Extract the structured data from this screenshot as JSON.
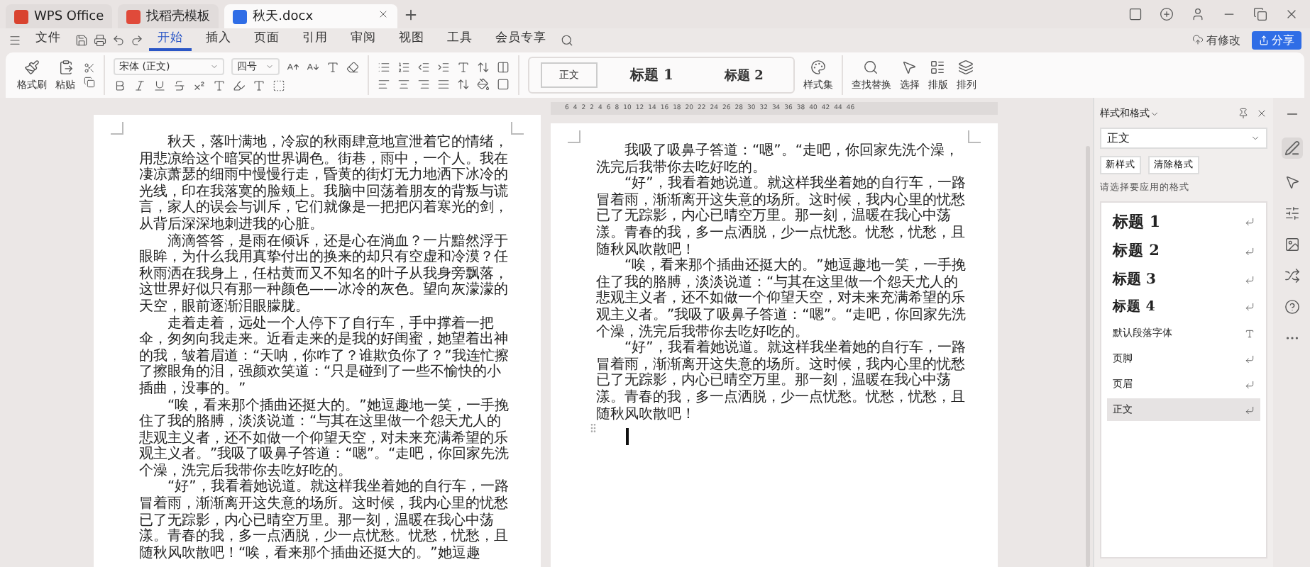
{
  "tabs": [
    {
      "label": "WPS Office",
      "kind": "home",
      "selected": false
    },
    {
      "label": "找稻壳模板",
      "kind": "template",
      "selected": false
    },
    {
      "label": "秋天.docx",
      "kind": "doc",
      "selected": true
    }
  ],
  "menu": {
    "file": "文件",
    "items": [
      {
        "label": "开始",
        "selected": true
      },
      {
        "label": "插入",
        "selected": false
      },
      {
        "label": "页面",
        "selected": false
      },
      {
        "label": "引用",
        "selected": false
      },
      {
        "label": "审阅",
        "selected": false
      },
      {
        "label": "视图",
        "selected": false
      },
      {
        "label": "工具",
        "selected": false
      },
      {
        "label": "会员专享",
        "selected": false
      }
    ]
  },
  "status": "有修改",
  "share": "分享",
  "ribbon": {
    "format_painter": "格式刷",
    "paste": "粘贴",
    "font": "宋体 (正文)",
    "size": "四号",
    "gallery": [
      {
        "label": "正文",
        "kind": "body",
        "selected": true
      },
      {
        "label": "标题 1",
        "kind": "h1",
        "selected": false
      },
      {
        "label": "标题 2",
        "kind": "h2",
        "selected": false
      }
    ],
    "tools": [
      {
        "label": "样式集",
        "kind": "styles"
      },
      {
        "label": "查找替换",
        "kind": "find"
      },
      {
        "label": "选择",
        "kind": "select"
      },
      {
        "label": "排版",
        "kind": "layout"
      },
      {
        "label": "排列",
        "kind": "arrange"
      }
    ]
  },
  "ruler": [
    "6",
    "4",
    "2",
    "2",
    "4",
    "6",
    "8",
    "10",
    "12",
    "14",
    "16",
    "18",
    "20",
    "22",
    "24",
    "26",
    "28",
    "30",
    "32",
    "34",
    "36",
    "38",
    "40",
    "42",
    "44",
    "46"
  ],
  "pages": [
    {
      "ruler": false,
      "paragraphs": [
        "秋天，落叶满地，冷寂的秋雨肆意地宣泄着它的情绪，用悲凉给这个暗冥的世界调色。街巷，雨中，一个人。我在凄凉萧瑟的细雨中慢慢行走，昏黄的街灯无力地洒下冰冷的光线，印在我落寞的脸颊上。我脑中回荡着朋友的背叛与谎言，家人的误会与训斥，它们就像是一把把闪着寒光的剑，从背后深深地刺进我的心脏。",
        "滴滴答答，是雨在倾诉，还是心在淌血？一片黯然浮于眼眸，为什么我用真挚付出的换来的却只有空虚和冷漠？任秋雨洒在我身上，任枯黄而又不知名的叶子从我身旁飘落，这世界好似只有那一种颜色——冰冷的灰色。望向灰濛濛的天空，眼前逐渐泪眼朦胧。",
        "走着走着，远处一个人停下了自行车，手中撑着一把伞，匆匆向我走来。近看走来的是我的好闺蜜，她望着出神的我，皱着眉道：“天呐，你咋了？谁欺负你了？”我连忙擦了擦眼角的泪，强颜欢笑道：“只是碰到了一些不愉快的小插曲，没事的。”",
        "“唉，看来那个插曲还挺大的。”她逗趣地一笑，一手挽住了我的胳膊，淡淡说道：“与其在这里做一个怨天尤人的悲观主义者，还不如做一个仰望天空，对未来充满希望的乐观主义者。”我吸了吸鼻子答道：“嗯”。“走吧，你回家先洗个澡，洗完后我带你去吃好吃的。",
        "“好”，我看着她说道。就这样我坐着她的自行车，一路冒着雨，渐渐离开这失意的场所。这时候，我内心里的忧愁已了无踪影，内心已晴空万里。那一刻，温暖在我心中荡漾。青春的我，多一点洒脱，少一点忧愁。忧愁，忧愁，且随秋风吹散吧！“唉，看来那个插曲还挺大的。”她逗趣"
      ]
    },
    {
      "ruler": true,
      "cursor": true,
      "paragraphs": [
        "我吸了吸鼻子答道：“嗯”。“走吧，你回家先洗个澡，洗完后我带你去吃好吃的。",
        "“好”，我看着她说道。就这样我坐着她的自行车，一路冒着雨，渐渐离开这失意的场所。这时候，我内心里的忧愁已了无踪影，内心已晴空万里。那一刻，温暖在我心中荡漾。青春的我，多一点洒脱，少一点忧愁。忧愁，忧愁，且随秋风吹散吧！",
        "“唉，看来那个插曲还挺大的。”她逗趣地一笑，一手挽住了我的胳膊，淡淡说道：“与其在这里做一个怨天尤人的悲观主义者，还不如做一个仰望天空，对未来充满希望的乐观主义者。”我吸了吸鼻子答道：“嗯”。“走吧，你回家先洗个澡，洗完后我带你去吃好吃的。",
        "“好”，我看着她说道。就这样我坐着她的自行车，一路冒着雨，渐渐离开这失意的场所。这时候，我内心里的忧愁已了无踪影，内心已晴空万里。那一刻，温暖在我心中荡漾。青春的我，多一点洒脱，少一点忧愁。忧愁，忧愁，且随秋风吹散吧！"
      ]
    }
  ],
  "styles_panel": {
    "title": "样式和格式",
    "current": "正文",
    "buttons": [
      "新样式",
      "清除格式"
    ],
    "hint": "请选择要应用的格式",
    "items": [
      {
        "label": "标题 1",
        "kind": "h1",
        "selected": false
      },
      {
        "label": "标题 2",
        "kind": "h2",
        "selected": false
      },
      {
        "label": "标题 3",
        "kind": "h3",
        "selected": false
      },
      {
        "label": "标题 4",
        "kind": "h4",
        "selected": false
      },
      {
        "label": "默认段落字体",
        "kind": "font",
        "selected": false
      },
      {
        "label": "页脚",
        "kind": "para",
        "selected": false
      },
      {
        "label": "页眉",
        "kind": "para",
        "selected": false
      },
      {
        "label": "正文",
        "kind": "para",
        "selected": true
      }
    ]
  }
}
